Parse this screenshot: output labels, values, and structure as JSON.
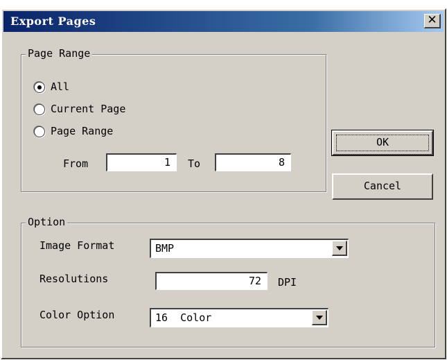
{
  "window": {
    "title": "Export Pages",
    "close_glyph": "✕"
  },
  "page_range_group": {
    "legend": "Page Range",
    "options": [
      {
        "label": "All",
        "selected": true
      },
      {
        "label": "Current Page",
        "selected": false
      },
      {
        "label": "Page Range",
        "selected": false
      }
    ],
    "from_label": "From",
    "from_value": "1",
    "to_label": "To",
    "to_value": "8"
  },
  "buttons": {
    "ok": "OK",
    "cancel": "Cancel"
  },
  "option_group": {
    "legend": "Option",
    "image_format_label": "Image Format",
    "image_format_value": "BMP",
    "resolutions_label": "Resolutions",
    "resolutions_value": "72",
    "resolutions_unit": "DPI",
    "color_option_label": "Color Option",
    "color_option_value": "16  Color"
  }
}
